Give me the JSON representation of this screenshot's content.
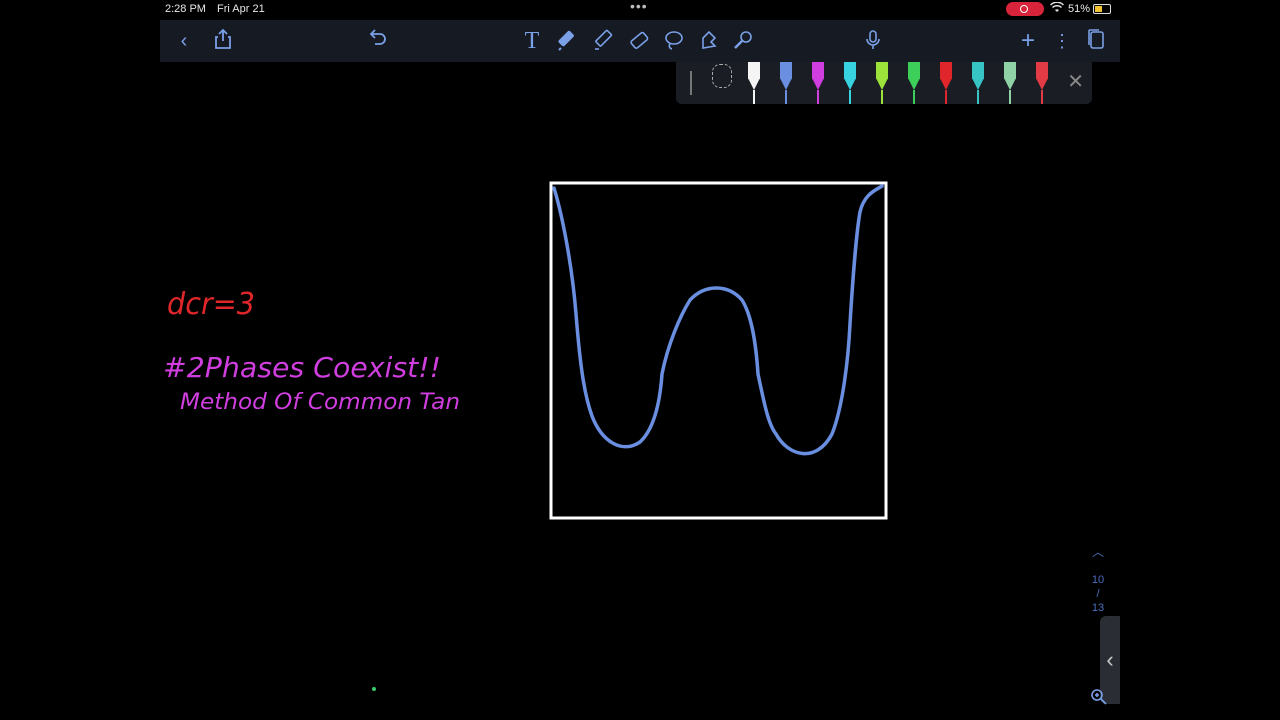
{
  "status_bar": {
    "time": "2:28 PM",
    "date": "Fri Apr 21",
    "battery": "51%"
  },
  "toolbar": {
    "icons": [
      "back-icon",
      "share-icon",
      "undo-icon",
      "text-tool-icon",
      "pen-tool-icon",
      "highlighter-icon",
      "eraser-icon",
      "lasso-icon",
      "shape-tool-icon",
      "laser-pointer-icon",
      "microphone-icon",
      "add-page-icon",
      "more-icon",
      "pages-icon"
    ]
  },
  "pen_colors": [
    "#f4f4f4",
    "#6a8fe0",
    "#d13ee0",
    "#37d3e0",
    "#9ce23a",
    "#3ccf5a",
    "#e0262a",
    "#36c4c4",
    "#8fd2a6",
    "#e23b45"
  ],
  "ink_colors": {
    "red": "#e0262a",
    "magenta": "#d13ee0",
    "curve": "#6a8fe0",
    "frame": "#ffffff"
  },
  "handwriting": {
    "line1": "dcr=3",
    "line2": "#2Phases Coexist!!",
    "line3": "Method Of Common Tan"
  },
  "page_indicator": {
    "current": "10",
    "separator": "/",
    "total": "13"
  }
}
